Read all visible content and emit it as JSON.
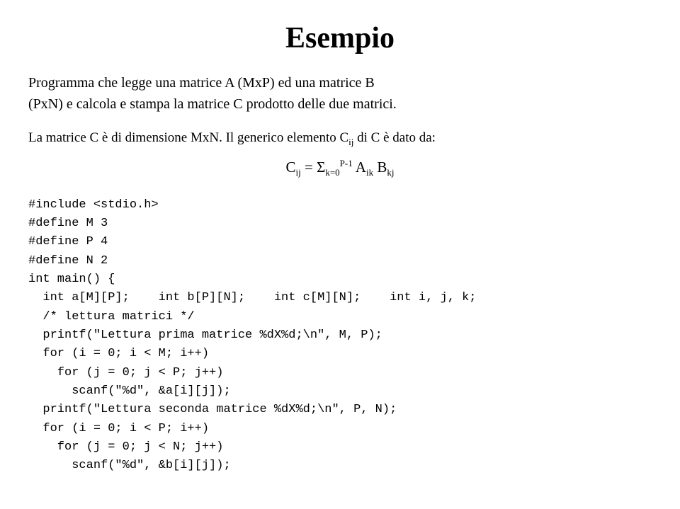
{
  "title": "Esempio",
  "intro": {
    "line1": "Programma che legge una matrice A (MxP) ed una matrice B",
    "line2": "(PxN) e calcola e stampa la matrice C prodotto delle due matrici."
  },
  "description": {
    "line1": "La matrice C è di dimensione MxN. Il generico elemento C",
    "subscript_ij": "ij",
    "line1_end": " di C è dato da:",
    "formula": "C",
    "formula_sub": "ij",
    "formula_eq": " = Σ",
    "formula_k": "k=0",
    "formula_exp": "P-1",
    "formula_a": " A",
    "formula_a_sub": "ik",
    "formula_b": " B",
    "formula_b_sub": "kj"
  },
  "code": {
    "lines": [
      "#include <stdio.h>",
      "#define M 3",
      "#define P 4",
      "#define N 2",
      "int main() {",
      "  int a[M][P];    int b[P][N];    int c[M][N];    int i, j, k;",
      "  /* lettura matrici */",
      "  printf(\"Lettura prima matrice %dX%d;\\n\", M, P);",
      "  for (i = 0; i < M; i++)",
      "    for (j = 0; j < P; j++)",
      "      scanf(\"%d\", &a[i][j]);",
      "  printf(\"Lettura seconda matrice %dX%d;\\n\", P, N);",
      "  for (i = 0; i < P; i++)",
      "    for (j = 0; j < N; j++)",
      "      scanf(\"%d\", &b[i][j]);"
    ]
  }
}
